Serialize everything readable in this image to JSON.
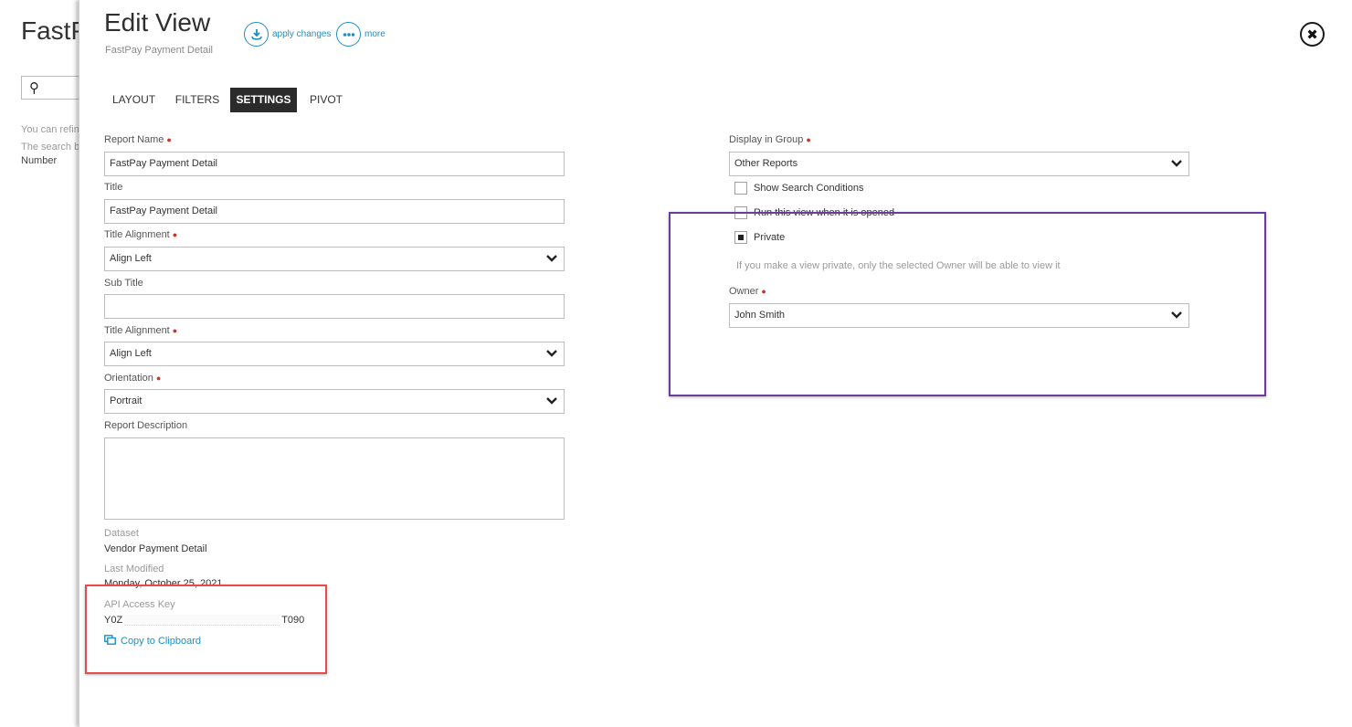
{
  "background": {
    "title": "FastPay",
    "hint_line1": "You can refine",
    "hint_line2": "The search b",
    "hint_line3": "Number"
  },
  "header": {
    "title": "Edit View",
    "subtitle": "FastPay Payment Detail",
    "apply_label": "apply changes",
    "more_label": "more"
  },
  "tabs": [
    {
      "label": "LAYOUT",
      "active": false
    },
    {
      "label": "FILTERS",
      "active": false
    },
    {
      "label": "SETTINGS",
      "active": true
    },
    {
      "label": "PIVOT",
      "active": false
    }
  ],
  "form": {
    "report_name": {
      "label": "Report Name",
      "value": "FastPay Payment Detail"
    },
    "title": {
      "label": "Title",
      "value": "FastPay Payment Detail"
    },
    "title_alignment": {
      "label": "Title Alignment",
      "value": "Align Left"
    },
    "sub_title": {
      "label": "Sub Title",
      "value": ""
    },
    "sub_title_alignment": {
      "label": "Title Alignment",
      "value": "Align Left"
    },
    "orientation": {
      "label": "Orientation",
      "value": "Portrait"
    },
    "report_description": {
      "label": "Report Description",
      "value": ""
    },
    "dataset": {
      "label": "Dataset",
      "value": "Vendor Payment Detail"
    },
    "last_modified": {
      "label": "Last Modified",
      "value": "Monday, October 25, 2021"
    },
    "api_key": {
      "label": "API Access Key",
      "value_start": "Y0Z",
      "value_end": "T090",
      "copy_label": "Copy to Clipboard"
    },
    "display_in_group": {
      "label": "Display in Group",
      "value": "Other Reports"
    },
    "show_search_conditions": {
      "label": "Show Search Conditions",
      "checked": false
    },
    "run_on_open": {
      "label": "Run this view when it is opened",
      "checked": false
    },
    "private": {
      "label": "Private",
      "checked": true
    },
    "private_hint": "If you make a view private, only the selected Owner will be able to view it",
    "owner": {
      "label": "Owner",
      "value": "John Smith"
    }
  },
  "colors": {
    "accent": "#1f8fc0",
    "required": "#c0392b",
    "highlight_red": "#e84b4b",
    "highlight_purple": "#6a3d9a",
    "active_tab": "#2b2b2b"
  }
}
